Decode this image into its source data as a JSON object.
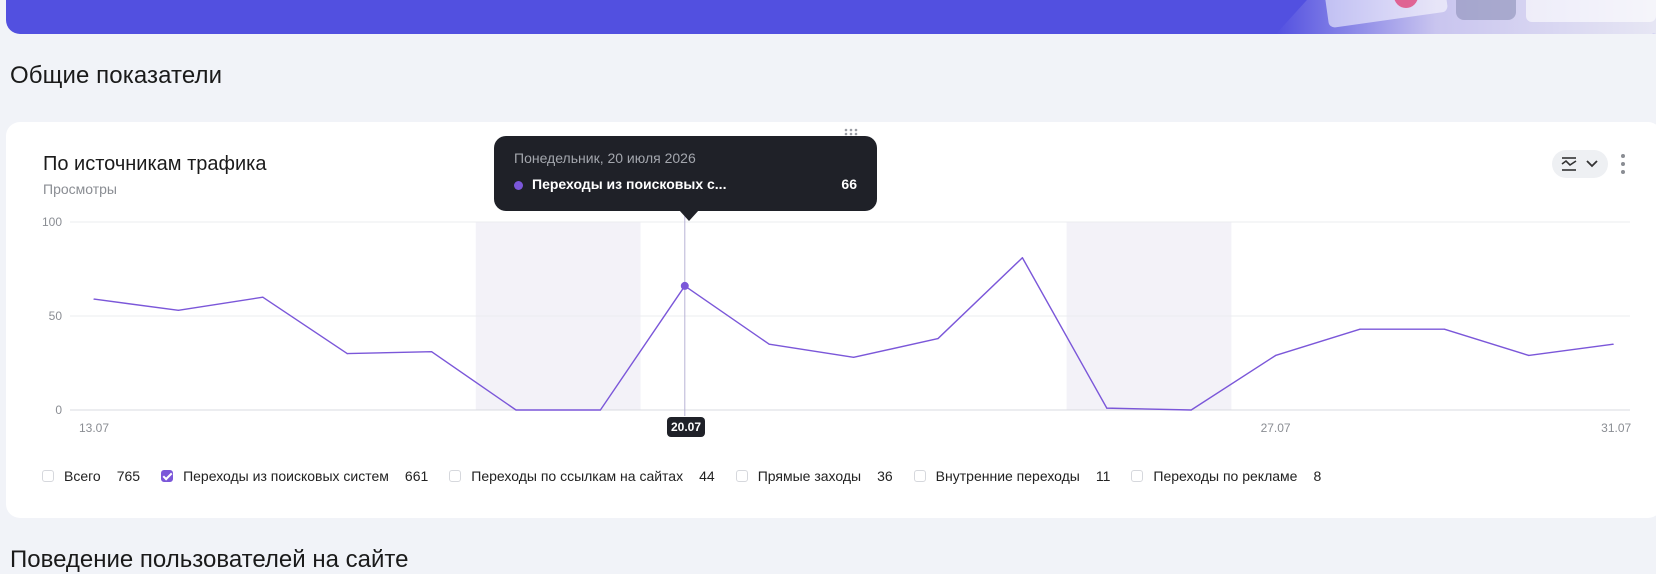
{
  "page": {
    "section_title": "Общие показатели",
    "next_section_title": "Поведение пользователей на сайте"
  },
  "card": {
    "title": "По источникам трафика",
    "subtitle": "Просмотры"
  },
  "tooltip": {
    "date": "Понедельник, 20 июля 2026",
    "series": "Переходы из поисковых с...",
    "value": "66"
  },
  "selected_date": "20.07",
  "icons": {
    "chart_type": "line-chart-icon",
    "dropdown": "chevron-down-icon",
    "more": "more-vertical-icon",
    "drag": "drag-handle-icon"
  },
  "colors": {
    "accent": "#7b57d9",
    "banner": "#5250e0",
    "tooltip_bg": "#1f2128"
  },
  "legend": [
    {
      "label": "Всего",
      "value": "765",
      "checked": false
    },
    {
      "label": "Переходы из поисковых систем",
      "value": "661",
      "checked": true
    },
    {
      "label": "Переходы по ссылкам на сайтах",
      "value": "44",
      "checked": false
    },
    {
      "label": "Прямые заходы",
      "value": "36",
      "checked": false
    },
    {
      "label": "Внутренние переходы",
      "value": "11",
      "checked": false
    },
    {
      "label": "Переходы по рекламе",
      "value": "8",
      "checked": false
    }
  ],
  "chart_data": {
    "type": "line",
    "x": [
      "13.07",
      "14.07",
      "15.07",
      "16.07",
      "17.07",
      "18.07",
      "19.07",
      "20.07",
      "21.07",
      "22.07",
      "23.07",
      "24.07",
      "25.07",
      "26.07",
      "27.07",
      "28.07",
      "29.07",
      "30.07",
      "31.07"
    ],
    "x_tick_labels": [
      "13.07",
      "20.07",
      "27.07",
      "31.07"
    ],
    "y_tick_labels": [
      "0",
      "50",
      "100"
    ],
    "ylim": [
      0,
      100
    ],
    "grid": true,
    "series": [
      {
        "name": "Переходы из поисковых систем",
        "color": "#7b57d9",
        "values": [
          59,
          53,
          60,
          30,
          31,
          0,
          0,
          66,
          35,
          28,
          38,
          81,
          1,
          0,
          29,
          43,
          43,
          29,
          35
        ]
      }
    ],
    "weekend_bands": [
      [
        "18.07",
        "19.07"
      ],
      [
        "25.07",
        "26.07"
      ]
    ],
    "highlight": "20.07"
  }
}
